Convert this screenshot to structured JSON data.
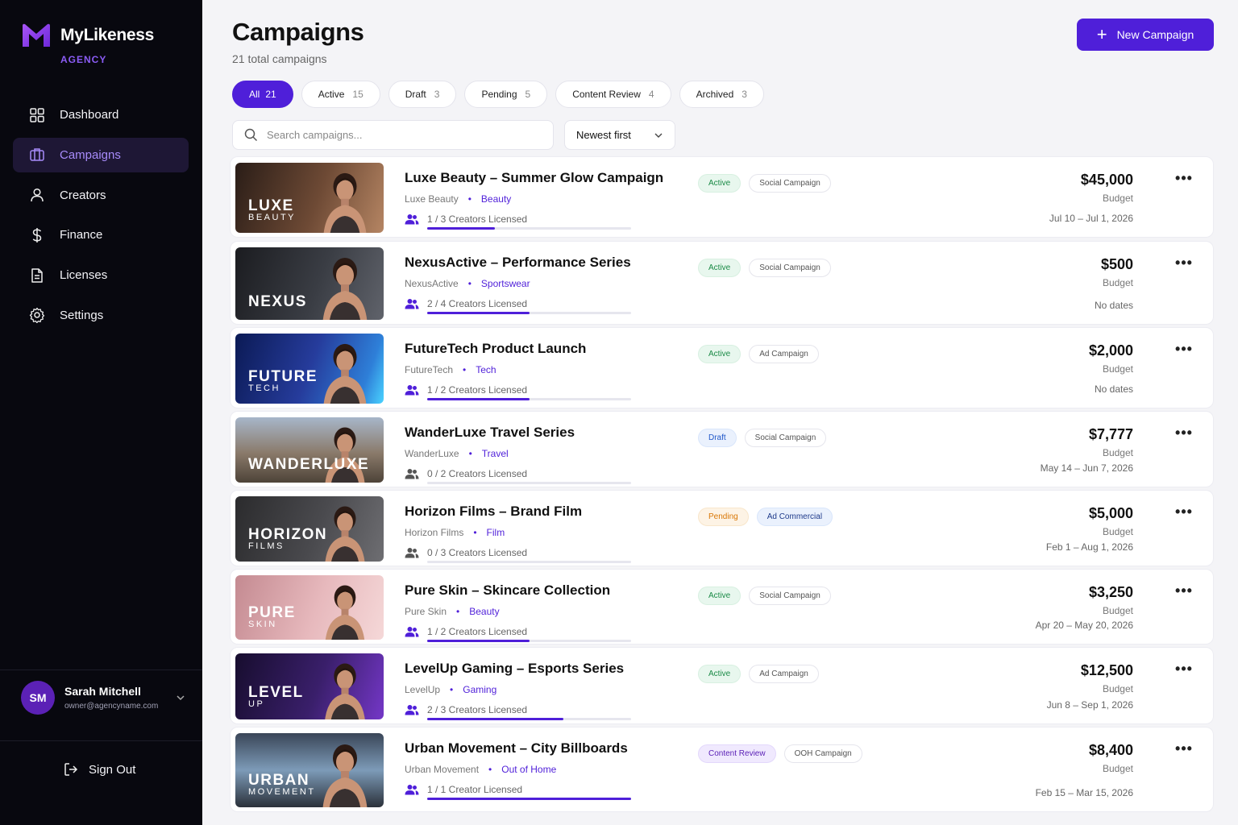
{
  "brand": {
    "name": "MyLikeness",
    "sub": "AGENCY"
  },
  "nav": [
    {
      "label": "Dashboard",
      "icon": "grid-icon",
      "active": false
    },
    {
      "label": "Campaigns",
      "icon": "briefcase-icon",
      "active": true
    },
    {
      "label": "Creators",
      "icon": "user-icon",
      "active": false
    },
    {
      "label": "Finance",
      "icon": "dollar-icon",
      "active": false
    },
    {
      "label": "Licenses",
      "icon": "document-icon",
      "active": false
    },
    {
      "label": "Settings",
      "icon": "gear-icon",
      "active": false
    }
  ],
  "user": {
    "initials": "SM",
    "name": "Sarah Mitchell",
    "email": "owner@agencyname.com"
  },
  "signout_label": "Sign Out",
  "header": {
    "title": "Campaigns",
    "subtitle": "21 total campaigns",
    "new_button": "New Campaign"
  },
  "filters": [
    {
      "label": "All",
      "count": "21",
      "active": true
    },
    {
      "label": "Active",
      "count": "15",
      "active": false
    },
    {
      "label": "Draft",
      "count": "3",
      "active": false
    },
    {
      "label": "Pending",
      "count": "5",
      "active": false
    },
    {
      "label": "Content Review",
      "count": "4",
      "active": false
    },
    {
      "label": "Archived",
      "count": "3",
      "active": false
    }
  ],
  "search": {
    "placeholder": "Search campaigns..."
  },
  "sort": {
    "value": "Newest first"
  },
  "colors": {
    "accent": "#4f1fd9",
    "sidebar_bg": "#08080f",
    "active_nav_bg": "#1e1735"
  },
  "campaigns": [
    {
      "title": "Luxe Beauty – Summer Glow Campaign",
      "brand": "Luxe Beauty",
      "category": "Beauty",
      "licensed": "1 / 3 Creators Licensed",
      "progress": 0.333,
      "status": "Active",
      "status_class": "s-active",
      "type": "Social Campaign",
      "type_class": "",
      "budget": "$45,000",
      "budget_label": "Budget",
      "dates": "Jul 10 – Jul 1, 2026",
      "logo_big": "LUXE",
      "logo_small": "BEAUTY",
      "theme": "luxe"
    },
    {
      "title": "NexusActive – Performance Series",
      "brand": "NexusActive",
      "category": "Sportswear",
      "licensed": "2 / 4 Creators Licensed",
      "progress": 0.5,
      "status": "Active",
      "status_class": "s-active",
      "type": "Social Campaign",
      "type_class": "",
      "budget": "$500",
      "budget_label": "Budget",
      "dates": "No dates",
      "logo_big": "NEXUS",
      "logo_small": "",
      "theme": "nexus"
    },
    {
      "title": "FutureTech Product Launch",
      "brand": "FutureTech",
      "category": "Tech",
      "licensed": "1 / 2 Creators Licensed",
      "progress": 0.5,
      "status": "Active",
      "status_class": "s-active",
      "type": "Ad Campaign",
      "type_class": "",
      "budget": "$2,000",
      "budget_label": "Budget",
      "dates": "No dates",
      "logo_big": "FUTURE",
      "logo_small": "TECH",
      "theme": "future"
    },
    {
      "title": "WanderLuxe Travel Series",
      "brand": "WanderLuxe",
      "category": "Travel",
      "licensed": "0 / 2 Creators Licensed",
      "progress": 0,
      "status": "Draft",
      "status_class": "s-draft",
      "type": "Social Campaign",
      "type_class": "",
      "budget": "$7,777",
      "budget_label": "Budget",
      "dates": "May 14 – Jun 7, 2026",
      "logo_big": "WANDERLUXE",
      "logo_small": "",
      "theme": "wander"
    },
    {
      "title": "Horizon Films – Brand Film",
      "brand": "Horizon Films",
      "category": "Film",
      "licensed": "0 / 3 Creators Licensed",
      "progress": 0,
      "status": "Pending",
      "status_class": "s-pending",
      "type": "Ad Commercial",
      "type_class": "t-blue",
      "budget": "$5,000",
      "budget_label": "Budget",
      "dates": "Feb 1 – Aug 1, 2026",
      "logo_big": "HORIZON",
      "logo_small": "FILMS",
      "theme": "horizon"
    },
    {
      "title": "Pure Skin – Skincare Collection",
      "brand": "Pure Skin",
      "category": "Beauty",
      "licensed": "1 / 2 Creators Licensed",
      "progress": 0.5,
      "status": "Active",
      "status_class": "s-active",
      "type": "Social Campaign",
      "type_class": "",
      "budget": "$3,250",
      "budget_label": "Budget",
      "dates": "Apr 20 – May 20, 2026",
      "logo_big": "PURE",
      "logo_small": "SKIN",
      "theme": "pure"
    },
    {
      "title": "LevelUp Gaming – Esports Series",
      "brand": "LevelUp",
      "category": "Gaming",
      "licensed": "2 / 3 Creators Licensed",
      "progress": 0.667,
      "status": "Active",
      "status_class": "s-active",
      "type": "Ad Campaign",
      "type_class": "",
      "budget": "$12,500",
      "budget_label": "Budget",
      "dates": "Jun 8 – Sep 1, 2026",
      "logo_big": "LEVEL",
      "logo_small": "UP",
      "theme": "level"
    },
    {
      "title": "Urban Movement – City Billboards",
      "brand": "Urban Movement",
      "category": "Out of Home",
      "licensed": "1 / 1 Creator Licensed",
      "progress": 1,
      "status": "Content Review",
      "status_class": "s-review",
      "type": "OOH Campaign",
      "type_class": "",
      "budget": "$8,400",
      "budget_label": "Budget",
      "dates": "Feb 15 – Mar 15, 2026",
      "logo_big": "URBAN",
      "logo_small": "MOVEMENT",
      "theme": "urban"
    }
  ]
}
